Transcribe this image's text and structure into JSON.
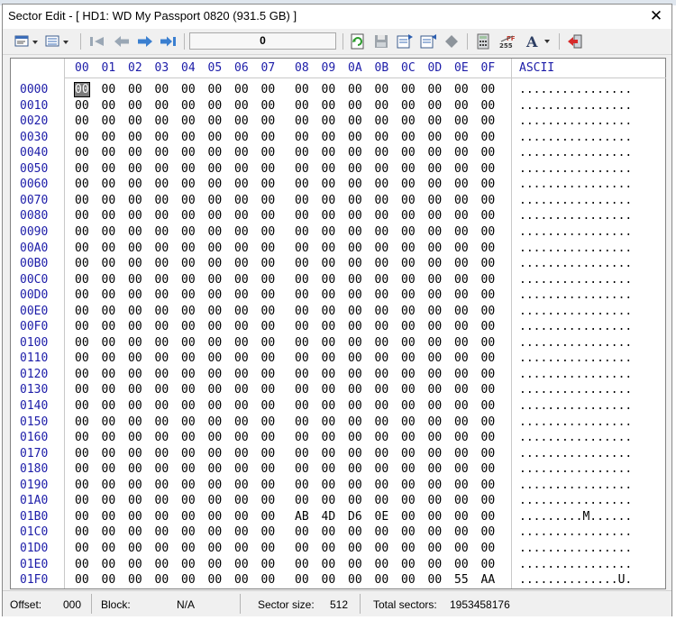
{
  "window": {
    "title": "Sector Edit - [ HD1: WD My Passport 0820 (931.5 GB) ]",
    "close_label": "✕"
  },
  "toolbar": {
    "sector_value": "0",
    "icons": [
      "view-mode-icon",
      "view-options-icon",
      "first-sector-icon",
      "previous-sector-icon",
      "next-sector-icon",
      "last-sector-icon",
      "refresh-icon",
      "save-icon",
      "copy-sector-icon",
      "paste-sector-icon",
      "fill-icon",
      "calculator-icon",
      "char-table-icon",
      "font-icon",
      "exit-icon"
    ]
  },
  "hex_view": {
    "column_headers": [
      "00",
      "01",
      "02",
      "03",
      "04",
      "05",
      "06",
      "07",
      "08",
      "09",
      "0A",
      "0B",
      "0C",
      "0D",
      "0E",
      "0F"
    ],
    "ascii_header": "ASCII",
    "rows": [
      {
        "offset": "0000",
        "bytes": [
          "00",
          "00",
          "00",
          "00",
          "00",
          "00",
          "00",
          "00",
          "00",
          "00",
          "00",
          "00",
          "00",
          "00",
          "00",
          "00"
        ],
        "ascii": "................"
      },
      {
        "offset": "0010",
        "bytes": [
          "00",
          "00",
          "00",
          "00",
          "00",
          "00",
          "00",
          "00",
          "00",
          "00",
          "00",
          "00",
          "00",
          "00",
          "00",
          "00"
        ],
        "ascii": "................"
      },
      {
        "offset": "0020",
        "bytes": [
          "00",
          "00",
          "00",
          "00",
          "00",
          "00",
          "00",
          "00",
          "00",
          "00",
          "00",
          "00",
          "00",
          "00",
          "00",
          "00"
        ],
        "ascii": "................"
      },
      {
        "offset": "0030",
        "bytes": [
          "00",
          "00",
          "00",
          "00",
          "00",
          "00",
          "00",
          "00",
          "00",
          "00",
          "00",
          "00",
          "00",
          "00",
          "00",
          "00"
        ],
        "ascii": "................"
      },
      {
        "offset": "0040",
        "bytes": [
          "00",
          "00",
          "00",
          "00",
          "00",
          "00",
          "00",
          "00",
          "00",
          "00",
          "00",
          "00",
          "00",
          "00",
          "00",
          "00"
        ],
        "ascii": "................"
      },
      {
        "offset": "0050",
        "bytes": [
          "00",
          "00",
          "00",
          "00",
          "00",
          "00",
          "00",
          "00",
          "00",
          "00",
          "00",
          "00",
          "00",
          "00",
          "00",
          "00"
        ],
        "ascii": "................"
      },
      {
        "offset": "0060",
        "bytes": [
          "00",
          "00",
          "00",
          "00",
          "00",
          "00",
          "00",
          "00",
          "00",
          "00",
          "00",
          "00",
          "00",
          "00",
          "00",
          "00"
        ],
        "ascii": "................"
      },
      {
        "offset": "0070",
        "bytes": [
          "00",
          "00",
          "00",
          "00",
          "00",
          "00",
          "00",
          "00",
          "00",
          "00",
          "00",
          "00",
          "00",
          "00",
          "00",
          "00"
        ],
        "ascii": "................"
      },
      {
        "offset": "0080",
        "bytes": [
          "00",
          "00",
          "00",
          "00",
          "00",
          "00",
          "00",
          "00",
          "00",
          "00",
          "00",
          "00",
          "00",
          "00",
          "00",
          "00"
        ],
        "ascii": "................"
      },
      {
        "offset": "0090",
        "bytes": [
          "00",
          "00",
          "00",
          "00",
          "00",
          "00",
          "00",
          "00",
          "00",
          "00",
          "00",
          "00",
          "00",
          "00",
          "00",
          "00"
        ],
        "ascii": "................"
      },
      {
        "offset": "00A0",
        "bytes": [
          "00",
          "00",
          "00",
          "00",
          "00",
          "00",
          "00",
          "00",
          "00",
          "00",
          "00",
          "00",
          "00",
          "00",
          "00",
          "00"
        ],
        "ascii": "................"
      },
      {
        "offset": "00B0",
        "bytes": [
          "00",
          "00",
          "00",
          "00",
          "00",
          "00",
          "00",
          "00",
          "00",
          "00",
          "00",
          "00",
          "00",
          "00",
          "00",
          "00"
        ],
        "ascii": "................"
      },
      {
        "offset": "00C0",
        "bytes": [
          "00",
          "00",
          "00",
          "00",
          "00",
          "00",
          "00",
          "00",
          "00",
          "00",
          "00",
          "00",
          "00",
          "00",
          "00",
          "00"
        ],
        "ascii": "................"
      },
      {
        "offset": "00D0",
        "bytes": [
          "00",
          "00",
          "00",
          "00",
          "00",
          "00",
          "00",
          "00",
          "00",
          "00",
          "00",
          "00",
          "00",
          "00",
          "00",
          "00"
        ],
        "ascii": "................"
      },
      {
        "offset": "00E0",
        "bytes": [
          "00",
          "00",
          "00",
          "00",
          "00",
          "00",
          "00",
          "00",
          "00",
          "00",
          "00",
          "00",
          "00",
          "00",
          "00",
          "00"
        ],
        "ascii": "................"
      },
      {
        "offset": "00F0",
        "bytes": [
          "00",
          "00",
          "00",
          "00",
          "00",
          "00",
          "00",
          "00",
          "00",
          "00",
          "00",
          "00",
          "00",
          "00",
          "00",
          "00"
        ],
        "ascii": "................"
      },
      {
        "offset": "0100",
        "bytes": [
          "00",
          "00",
          "00",
          "00",
          "00",
          "00",
          "00",
          "00",
          "00",
          "00",
          "00",
          "00",
          "00",
          "00",
          "00",
          "00"
        ],
        "ascii": "................"
      },
      {
        "offset": "0110",
        "bytes": [
          "00",
          "00",
          "00",
          "00",
          "00",
          "00",
          "00",
          "00",
          "00",
          "00",
          "00",
          "00",
          "00",
          "00",
          "00",
          "00"
        ],
        "ascii": "................"
      },
      {
        "offset": "0120",
        "bytes": [
          "00",
          "00",
          "00",
          "00",
          "00",
          "00",
          "00",
          "00",
          "00",
          "00",
          "00",
          "00",
          "00",
          "00",
          "00",
          "00"
        ],
        "ascii": "................"
      },
      {
        "offset": "0130",
        "bytes": [
          "00",
          "00",
          "00",
          "00",
          "00",
          "00",
          "00",
          "00",
          "00",
          "00",
          "00",
          "00",
          "00",
          "00",
          "00",
          "00"
        ],
        "ascii": "................"
      },
      {
        "offset": "0140",
        "bytes": [
          "00",
          "00",
          "00",
          "00",
          "00",
          "00",
          "00",
          "00",
          "00",
          "00",
          "00",
          "00",
          "00",
          "00",
          "00",
          "00"
        ],
        "ascii": "................"
      },
      {
        "offset": "0150",
        "bytes": [
          "00",
          "00",
          "00",
          "00",
          "00",
          "00",
          "00",
          "00",
          "00",
          "00",
          "00",
          "00",
          "00",
          "00",
          "00",
          "00"
        ],
        "ascii": "................"
      },
      {
        "offset": "0160",
        "bytes": [
          "00",
          "00",
          "00",
          "00",
          "00",
          "00",
          "00",
          "00",
          "00",
          "00",
          "00",
          "00",
          "00",
          "00",
          "00",
          "00"
        ],
        "ascii": "................"
      },
      {
        "offset": "0170",
        "bytes": [
          "00",
          "00",
          "00",
          "00",
          "00",
          "00",
          "00",
          "00",
          "00",
          "00",
          "00",
          "00",
          "00",
          "00",
          "00",
          "00"
        ],
        "ascii": "................"
      },
      {
        "offset": "0180",
        "bytes": [
          "00",
          "00",
          "00",
          "00",
          "00",
          "00",
          "00",
          "00",
          "00",
          "00",
          "00",
          "00",
          "00",
          "00",
          "00",
          "00"
        ],
        "ascii": "................"
      },
      {
        "offset": "0190",
        "bytes": [
          "00",
          "00",
          "00",
          "00",
          "00",
          "00",
          "00",
          "00",
          "00",
          "00",
          "00",
          "00",
          "00",
          "00",
          "00",
          "00"
        ],
        "ascii": "................"
      },
      {
        "offset": "01A0",
        "bytes": [
          "00",
          "00",
          "00",
          "00",
          "00",
          "00",
          "00",
          "00",
          "00",
          "00",
          "00",
          "00",
          "00",
          "00",
          "00",
          "00"
        ],
        "ascii": "................"
      },
      {
        "offset": "01B0",
        "bytes": [
          "00",
          "00",
          "00",
          "00",
          "00",
          "00",
          "00",
          "00",
          "AB",
          "4D",
          "D6",
          "0E",
          "00",
          "00",
          "00",
          "00"
        ],
        "ascii": ".........M......"
      },
      {
        "offset": "01C0",
        "bytes": [
          "00",
          "00",
          "00",
          "00",
          "00",
          "00",
          "00",
          "00",
          "00",
          "00",
          "00",
          "00",
          "00",
          "00",
          "00",
          "00"
        ],
        "ascii": "................"
      },
      {
        "offset": "01D0",
        "bytes": [
          "00",
          "00",
          "00",
          "00",
          "00",
          "00",
          "00",
          "00",
          "00",
          "00",
          "00",
          "00",
          "00",
          "00",
          "00",
          "00"
        ],
        "ascii": "................"
      },
      {
        "offset": "01E0",
        "bytes": [
          "00",
          "00",
          "00",
          "00",
          "00",
          "00",
          "00",
          "00",
          "00",
          "00",
          "00",
          "00",
          "00",
          "00",
          "00",
          "00"
        ],
        "ascii": "................"
      },
      {
        "offset": "01F0",
        "bytes": [
          "00",
          "00",
          "00",
          "00",
          "00",
          "00",
          "00",
          "00",
          "00",
          "00",
          "00",
          "00",
          "00",
          "00",
          "55",
          "AA"
        ],
        "ascii": "..............U."
      }
    ]
  },
  "status": {
    "offset_label": "Offset:",
    "offset_value": "000",
    "block_label": "Block:",
    "block_value": "N/A",
    "sector_size_label": "Sector size:",
    "sector_size_value": "512",
    "total_sectors_label": "Total sectors:",
    "total_sectors_value": "1953458176"
  },
  "colors": {
    "header_text": "#1c1ca8",
    "cursor": "#7a7a7a"
  }
}
